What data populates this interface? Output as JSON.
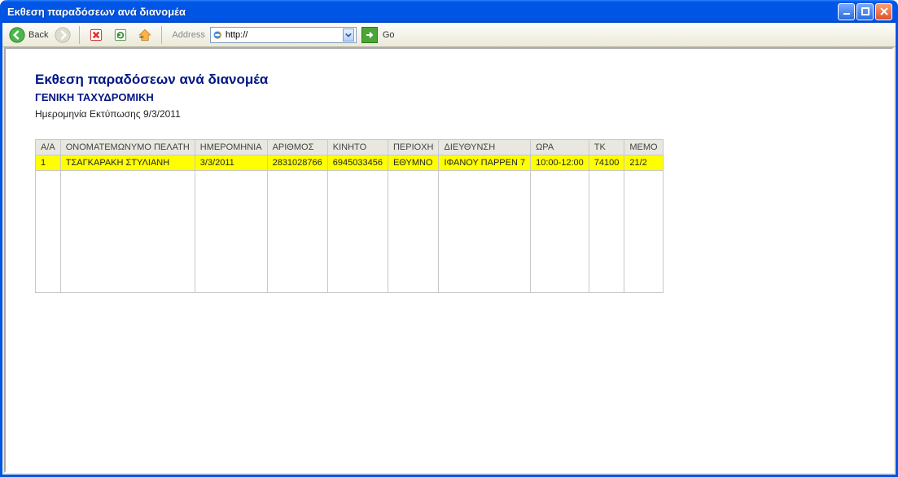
{
  "window": {
    "title": "Εκθεση παραδόσεων ανά διανομέα"
  },
  "toolbar": {
    "back_label": "Back",
    "address_label": "Address",
    "url_value": "http://",
    "go_label": "Go"
  },
  "report": {
    "title": "Εκθεση παραδόσεων ανά διανομέα",
    "subtitle": "ΓΕΝΙΚΗ ΤΑΧΥΔΡΟΜΙΚΗ",
    "print_date_line": "Ημερομηνία Εκτύπωσης 9/3/2011",
    "columns": [
      "Α/Α",
      "ΟΝΟΜΑΤΕΜΩΝΥΜΟ ΠΕΛΑΤΗ",
      "ΗΜΕΡΟΜΗΝΙΑ",
      "ΑΡΙΘΜΟΣ",
      "ΚΙΝΗΤΟ",
      "ΠΕΡΙΟΧΗ",
      "ΔΙΕΥΘΥΝΣΗ",
      "ΩΡΑ",
      "ΤΚ",
      "ΜΕΜΟ"
    ],
    "rows": [
      {
        "aa": "1",
        "name": "ΤΣΑΓΚΑΡΑΚΗ ΣΤΥΛΙΑΝΗ",
        "date": "3/3/2011",
        "number": "2831028766",
        "mobile": "6945033456",
        "region": "ΕΘΥΜΝΟ",
        "address": "ΙΦΑΝΟΥ ΠΑΡΡΕΝ 7",
        "time": "10:00-12:00",
        "tk": "74100",
        "memo": "21/2"
      }
    ]
  }
}
